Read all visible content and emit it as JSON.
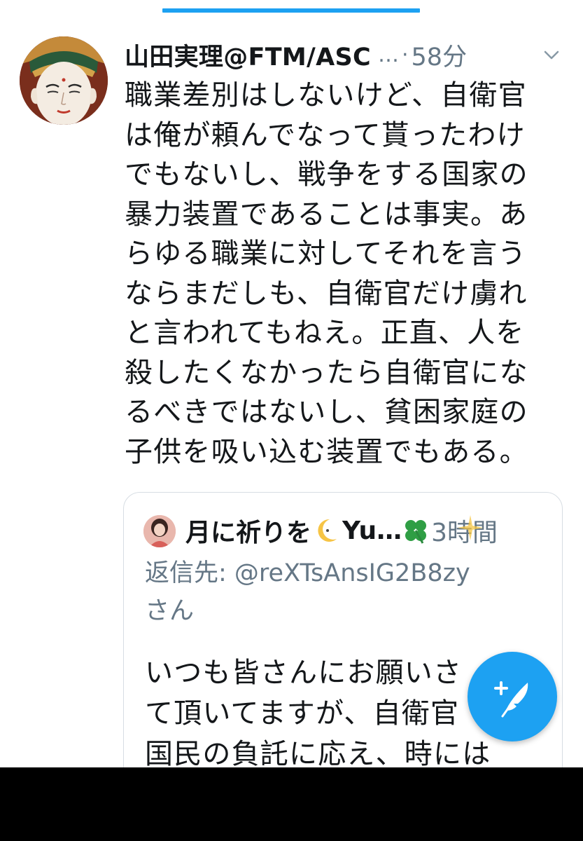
{
  "tweet": {
    "author": "山田実理@FTM/ASC",
    "ellipsis": "…",
    "separator": "·",
    "time": "58分",
    "text": "職業差別はしないけど、自衛官\nは俺が頼んでなって貰ったわけ\nでもないし、戦争をする国家の\n暴力装置であることは事実。あ\nらゆる職業に対してそれを言う\nならまだしも、自衛官だけ虜れ\nと言われてもねえ。正直、人を\n殺したくなかったら自衛官にな\nるべきではないし、貧困家庭の\n子供を吸い込む装置でもある。"
  },
  "quote": {
    "author": "月に祈りを",
    "name_suffix": "Yu…",
    "time": "3時間",
    "reply_label": "返信先: @reXTsAnsIG2B8zy",
    "reply_suffix": "さん",
    "text": "いつも皆さんにお願いさ\nて頂いてますが、自衛官\n国民の負託に応え、時には"
  },
  "icons": {
    "chevron": "chevron-down-icon",
    "moon": "crescent-moon-icon",
    "clover": "four-leaf-clover-icon",
    "sparkle": "sparkle-icon",
    "compose": "compose-tweet-icon"
  },
  "colors": {
    "accent": "#1da1f2",
    "text": "#14171a",
    "secondary": "#657786",
    "border": "#d7dde3"
  }
}
